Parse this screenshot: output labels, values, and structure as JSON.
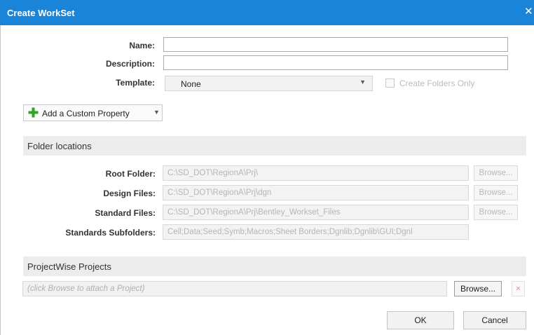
{
  "window": {
    "title": "Create WorkSet",
    "close_glyph": "✕"
  },
  "form": {
    "name_label": "Name:",
    "name_value": "",
    "description_label": "Description:",
    "description_value": "",
    "template_label": "Template:",
    "template_value": "None",
    "create_folders_only_label": "Create Folders Only",
    "create_folders_only_checked": false,
    "create_folders_only_enabled": false
  },
  "add_property": {
    "label": "Add a Custom Property",
    "icon": "plus-icon"
  },
  "folder_locations": {
    "heading": "Folder locations",
    "rows": [
      {
        "label": "Root Folder:",
        "value": "C:\\SD_DOT\\RegionA\\Prj\\",
        "browse": "Browse..."
      },
      {
        "label": "Design Files:",
        "value": "C:\\SD_DOT\\RegionA\\Prj\\dgn",
        "browse": "Browse..."
      },
      {
        "label": "Standard Files:",
        "value": "C:\\SD_DOT\\RegionA\\Prj\\Bentley_Workset_Files",
        "browse": "Browse..."
      },
      {
        "label": "Standards Subfolders:",
        "value": "Cell;Data;Seed;Symb;Macros;Sheet Borders;Dgnlib;Dgnlib\\GUI;Dgnl"
      }
    ]
  },
  "projectwise": {
    "heading": "ProjectWise Projects",
    "placeholder": "(click Browse to attach a Project)",
    "browse": "Browse...",
    "remove_glyph": "×"
  },
  "footer": {
    "ok": "OK",
    "cancel": "Cancel"
  },
  "colors": {
    "titlebar": "#1a84d8",
    "plus": "#2fa52f"
  }
}
